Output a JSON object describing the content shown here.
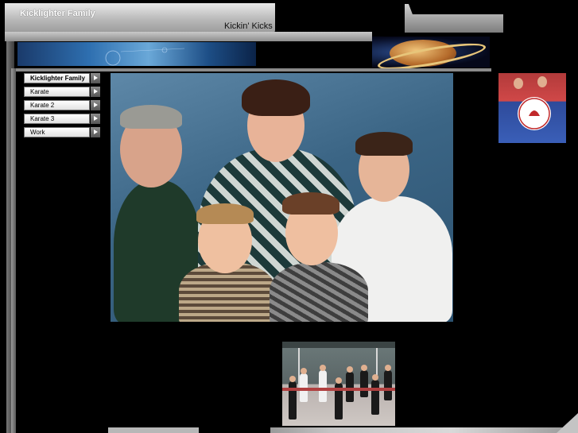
{
  "header": {
    "site_title": "Kicklighter Family",
    "site_subtitle": "Kickin' Kicks"
  },
  "nav": {
    "items": [
      {
        "label": "Kicklighter Family",
        "active": true
      },
      {
        "label": "Karate",
        "active": false
      },
      {
        "label": "Karate 2",
        "active": false
      },
      {
        "label": "Karate 3",
        "active": false
      },
      {
        "label": "Work",
        "active": false
      }
    ]
  },
  "colors": {
    "background": "#000000",
    "chrome": "#b8b8b8",
    "title_text": "#ffffff"
  }
}
